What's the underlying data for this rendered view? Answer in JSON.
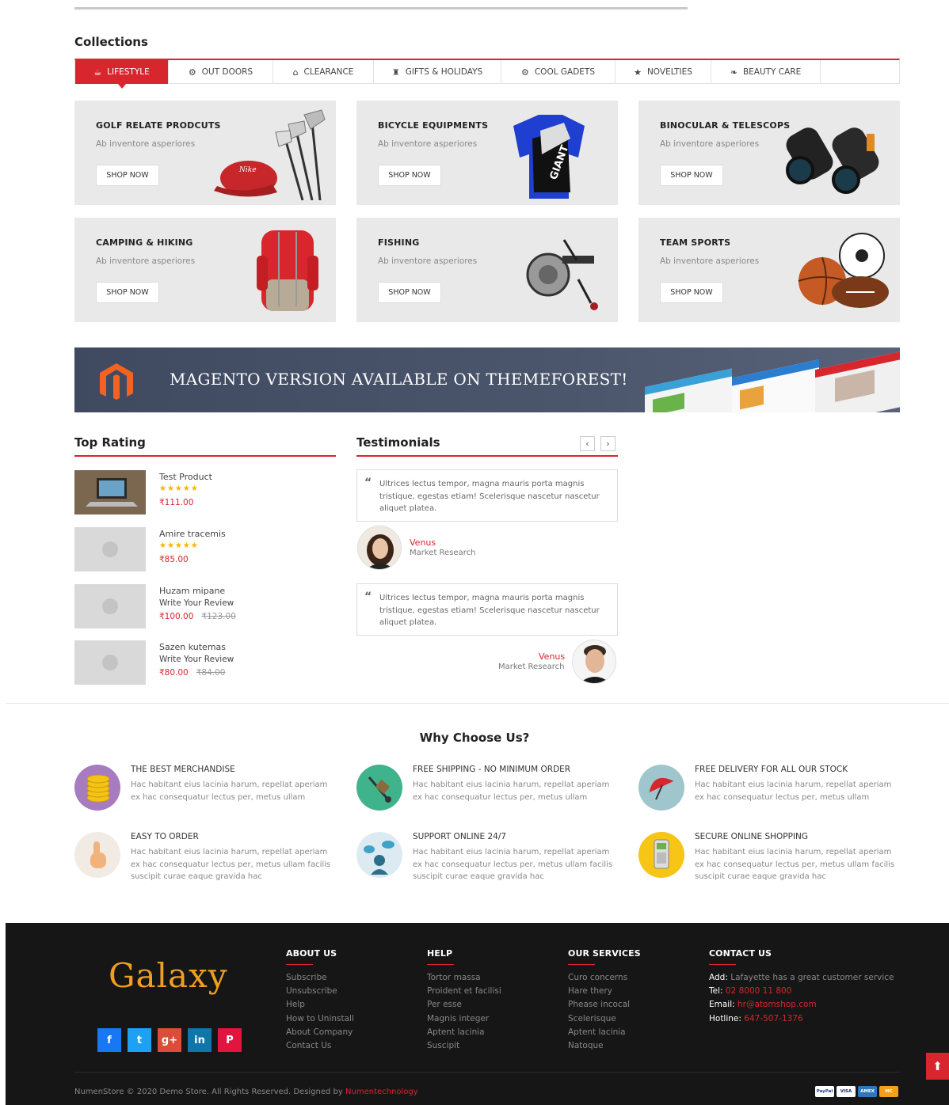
{
  "collections": {
    "title": "Collections",
    "tabs": [
      {
        "label": "LIFESTYLE",
        "icon": "cup-icon",
        "active": true
      },
      {
        "label": "OUT DOORS",
        "icon": "gear-icon"
      },
      {
        "label": "CLEARANCE",
        "icon": "home-icon"
      },
      {
        "label": "GIFTS & HOLIDAYS",
        "icon": "gift-icon"
      },
      {
        "label": "COOL GADETS",
        "icon": "cogs-icon"
      },
      {
        "label": "NOVELTIES",
        "icon": "star-icon"
      },
      {
        "label": "BEAUTY CARE",
        "icon": "leaf-icon"
      }
    ],
    "cards": [
      {
        "title": "GOLF RELATE PRODCUTS",
        "desc": "Ab inventore asperiores",
        "button": "SHOP NOW"
      },
      {
        "title": "BICYCLE EQUIPMENTS",
        "desc": "Ab inventore asperiores",
        "button": "SHOP NOW"
      },
      {
        "title": "BINOCULAR & TELESCOPS",
        "desc": "Ab inventore asperiores",
        "button": "SHOP NOW"
      },
      {
        "title": "CAMPING & HIKING",
        "desc": "Ab inventore asperiores",
        "button": "SHOP NOW"
      },
      {
        "title": "FISHING",
        "desc": "Ab inventore asperiores",
        "button": "SHOP NOW"
      },
      {
        "title": "TEAM SPORTS",
        "desc": "Ab inventore asperiores",
        "button": "SHOP NOW"
      }
    ]
  },
  "banner": {
    "text": "MAGENTO VERSION AVAILABLE ON THEMEFOREST!"
  },
  "top_rating": {
    "title": "Top Rating",
    "products": [
      {
        "name": "Test Product",
        "rating": "5 stars",
        "stars": "★★★★★",
        "price": "₹111.00"
      },
      {
        "name": "Amire tracemis",
        "rating": "5 stars",
        "stars": "★★★★★",
        "price": "₹85.00"
      },
      {
        "name": "Huzam mipane",
        "review": "Write Your Review",
        "price": "₹100.00",
        "old_price": "₹123.00"
      },
      {
        "name": "Sazen kutemas",
        "review": "Write Your Review",
        "price": "₹80.00",
        "old_price": "₹84.00"
      }
    ]
  },
  "testimonials": {
    "title": "Testimonials",
    "prev": "‹",
    "next": "›",
    "items": [
      {
        "text": "Ultrices lectus tempor, magna mauris porta magnis tristique, egestas etiam! Scelerisque nascetur nascetur aliquet platea.",
        "name": "Venus",
        "role": "Market Research"
      },
      {
        "text": "Ultrices lectus tempor, magna mauris porta magnis tristique, egestas etiam! Scelerisque nascetur nascetur aliquet platea.",
        "name": "Venus",
        "role": "Market Research"
      }
    ]
  },
  "why": {
    "title": "Why Choose Us?",
    "features": [
      {
        "title": "THE BEST MERCHANDISE",
        "desc": "Hac habitant eius lacinia harum, repellat aperiam ex hac consequatur lectus per, metus ullam",
        "icon": "coins-icon",
        "color": "#a77bbf"
      },
      {
        "title": "FREE SHIPPING - NO MINIMUM ORDER",
        "desc": "Hac habitant eius lacinia harum, repellat aperiam ex hac consequatur lectus per, metus ullam",
        "icon": "hand-truck-icon",
        "color": "#3fb38b"
      },
      {
        "title": "FREE DELIVERY FOR ALL OUR STOCK",
        "desc": "Hac habitant eius lacinia harum, repellat aperiam ex hac consequatur lectus per, metus ullam",
        "icon": "umbrella-icon",
        "color": "#9fc6cc"
      },
      {
        "title": "EASY TO ORDER",
        "desc": "Hac habitant eius lacinia harum, repellat aperiam ex hac consequatur lectus per, metus ullam facilis suscipit curae eaque gravida hac",
        "icon": "finger-tap-icon",
        "color": "#f1ebe4"
      },
      {
        "title": "SUPPORT ONLINE 24/7",
        "desc": "Hac habitant eius lacinia harum, repellat aperiam ex hac consequatur lectus per, metus ullam facilis suscipit curae eaque gravida hac",
        "icon": "chat-support-icon",
        "color": "#dcebf2"
      },
      {
        "title": "SECURE ONLINE SHOPPING",
        "desc": "Hac habitant eius lacinia harum, repellat aperiam ex hac consequatur lectus per, metus ullam facilis suscipit curae eaque gravida hac",
        "icon": "card-reader-icon",
        "color": "#f6c515"
      }
    ]
  },
  "footer": {
    "logo": "Galaxy",
    "socials": [
      {
        "name": "facebook-icon",
        "glyph": "f",
        "color": "#1877f2"
      },
      {
        "name": "twitter-icon",
        "glyph": "t",
        "color": "#1da1f2"
      },
      {
        "name": "google-plus-icon",
        "glyph": "g+",
        "color": "#dd4b39"
      },
      {
        "name": "linkedin-icon",
        "glyph": "in",
        "color": "#0e76a8"
      },
      {
        "name": "pinterest-icon",
        "glyph": "P",
        "color": "#e2153f"
      }
    ],
    "about": {
      "title": "ABOUT US",
      "links": [
        "Subscribe",
        "Unsubscribe",
        "Help",
        "How to Uninstall",
        "About Company",
        "Contact Us"
      ]
    },
    "help": {
      "title": "HELP",
      "links": [
        "Tortor massa",
        "Proident et facilisi",
        "Per esse",
        "Magnis integer",
        "Aptent lacinia",
        "Suscipit"
      ]
    },
    "services": {
      "title": "OUR SERVICES",
      "links": [
        "Curo concerns",
        "Hare thery",
        "Pheasе incocal",
        "Scelerisque",
        "Aptent lacinia",
        "Natoque"
      ]
    },
    "contact": {
      "title": "CONTACT US",
      "add_label": "Add:",
      "add": "Lafayette has a great customer service",
      "tel_label": "Tel:",
      "tel": "02 8000 11 800",
      "email_label": "Email:",
      "email": "hr@atomshop.com",
      "hotline_label": "Hotline:",
      "hotline": "647-507-1376"
    },
    "copyright": "NumenStore © 2020 Demo Store. All Rights Reserved. Designed by",
    "designer": "Numentechnology",
    "payments": [
      "PayPal",
      "VISA",
      "AMEX",
      "MC"
    ]
  },
  "accent": "#d7262d"
}
